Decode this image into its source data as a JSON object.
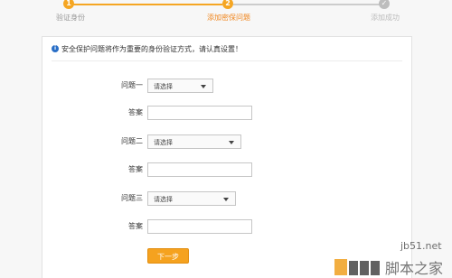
{
  "steps": [
    {
      "number": "1",
      "label": "验证身份",
      "state": "done"
    },
    {
      "number": "2",
      "label": "添加密保问题",
      "state": "current"
    },
    {
      "number": "✓",
      "label": "添加成功",
      "state": "pending"
    }
  ],
  "notice": {
    "icon": "info-icon",
    "text": "安全保护问题将作为重要的身份验证方式，请认真设置！"
  },
  "form": {
    "q1_label": "问题一",
    "q1_value": "请选择",
    "a1_label": "答案",
    "q2_label": "问题二",
    "q2_value": "请选择",
    "a2_label": "答案",
    "q3_label": "问题三",
    "q3_value": "请选择",
    "a3_label": "答案",
    "next_label": "下一步"
  },
  "watermark": {
    "site": "jb51.net",
    "logo_text": "脚本之家"
  },
  "colors": {
    "accent": "#f5a623",
    "button": "#f5a21f",
    "pending": "#bdbdbd",
    "info": "#2a6fc7"
  }
}
